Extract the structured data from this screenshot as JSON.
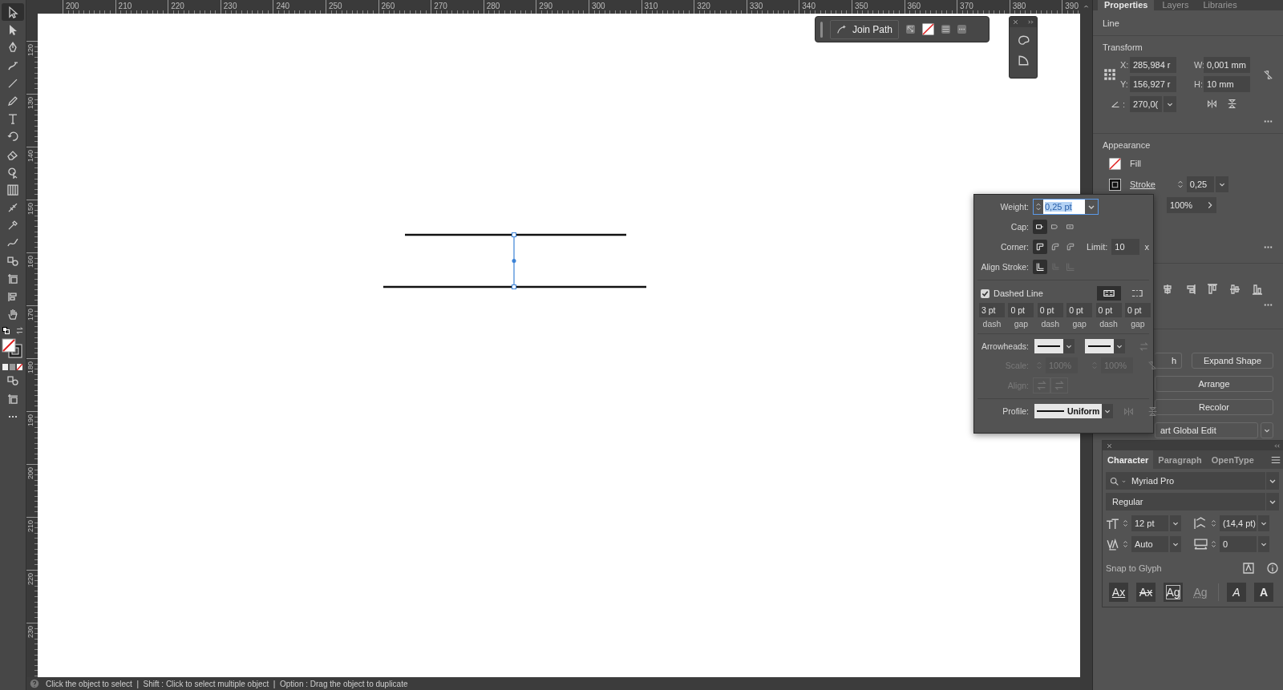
{
  "tools": [
    {
      "kind": "selection",
      "selected": true
    },
    {
      "kind": "direct-selection",
      "selected": false
    },
    {
      "kind": "pen",
      "selected": false
    },
    {
      "kind": "curvature",
      "selected": false
    },
    {
      "kind": "line",
      "selected": false
    },
    {
      "kind": "pencil",
      "selected": false
    },
    {
      "kind": "type",
      "selected": false
    },
    {
      "kind": "rotate",
      "selected": false
    },
    {
      "kind": "eraser",
      "selected": false
    },
    {
      "kind": "shape-builder",
      "selected": false
    },
    {
      "kind": "gradient",
      "selected": false
    },
    {
      "kind": "width",
      "selected": false
    },
    {
      "kind": "eyedropper",
      "selected": false
    },
    {
      "kind": "blend",
      "selected": false
    },
    {
      "kind": "shapes",
      "selected": false
    },
    {
      "kind": "artboard",
      "selected": false
    },
    {
      "kind": "graph",
      "selected": false
    },
    {
      "kind": "hand",
      "selected": false
    }
  ],
  "rulers": {
    "horizontal": [
      "200",
      "210",
      "220",
      "230",
      "240",
      "250",
      "260",
      "270",
      "280",
      "290",
      "300",
      "310",
      "320",
      "330",
      "340",
      "350",
      "360",
      "370",
      "380",
      "390"
    ],
    "vertical": [
      "120",
      "130",
      "140",
      "150",
      "160",
      "170",
      "180",
      "190",
      "200",
      "210",
      "220",
      "230"
    ]
  },
  "control_bar": {
    "join_path": "Join Path"
  },
  "properties_panel": {
    "tabs": [
      {
        "label": "Properties",
        "selected": true
      },
      {
        "label": "Layers",
        "selected": false
      },
      {
        "label": "Libraries",
        "selected": false
      }
    ],
    "object_type": "Line",
    "transform": {
      "title": "Transform",
      "fields": [
        {
          "label": "X:",
          "value": "285,984 r"
        },
        {
          "label": "W:",
          "value": "0,001 mm"
        },
        {
          "label": "Y:",
          "value": "156,927 r"
        },
        {
          "label": "H:",
          "value": "10 mm"
        }
      ],
      "angle_label": ":",
      "angle": "270,0("
    },
    "appearance": {
      "title": "Appearance",
      "fill_label": "Fill",
      "stroke_label": "Stroke",
      "stroke_weight": "0,25",
      "opacity": "100%"
    },
    "quick_actions": [
      {
        "label": "h",
        "kind": "half"
      },
      {
        "label": "Expand Shape",
        "kind": "half"
      },
      {
        "label": "Arrange",
        "kind": "full"
      },
      {
        "label": "Recolor",
        "kind": "full"
      },
      {
        "label": "art Global Edit",
        "kind": "split"
      }
    ]
  },
  "stroke_popup": {
    "weight_label": "Weight:",
    "weight": "0,25 pt",
    "weight_text_selected": true,
    "cap_label": "Cap:",
    "caps": [
      {
        "kind": "butt",
        "selected": true
      },
      {
        "kind": "round",
        "selected": false
      },
      {
        "kind": "projecting",
        "selected": false
      }
    ],
    "corner_label": "Corner:",
    "corners": [
      {
        "kind": "miter",
        "selected": true
      },
      {
        "kind": "round",
        "selected": false
      },
      {
        "kind": "bevel",
        "selected": false
      }
    ],
    "limit_label": "Limit:",
    "limit": "10",
    "limit_unit": "x",
    "align_label": "Align Stroke:",
    "aligns": [
      {
        "kind": "center",
        "selected": true,
        "disabled": false
      },
      {
        "kind": "inside",
        "selected": false,
        "disabled": true
      },
      {
        "kind": "outside",
        "selected": false,
        "disabled": true
      }
    ],
    "dashed": {
      "label": "Dashed Line",
      "checked": true
    },
    "dash_styles": [
      {
        "kind": "exact",
        "selected": true
      },
      {
        "kind": "adjusted",
        "selected": false
      }
    ],
    "dash_fields": [
      {
        "value": "3 pt",
        "label": "dash"
      },
      {
        "value": "0 pt",
        "label": "gap"
      },
      {
        "value": "0 pt",
        "label": "dash"
      },
      {
        "value": "0 pt",
        "label": "gap"
      },
      {
        "value": "0 pt",
        "label": "dash"
      },
      {
        "value": "0 pt",
        "label": "gap"
      }
    ],
    "arrowheads_label": "Arrowheads:",
    "scale": {
      "label": "Scale:",
      "values": [
        "100%",
        "100%"
      ],
      "disabled": true
    },
    "align_arrows": {
      "label": "Align:",
      "disabled": true
    },
    "profile": {
      "label": "Profile:",
      "value": "Uniform"
    }
  },
  "character_panel": {
    "tabs": [
      {
        "label": "Character",
        "selected": true
      },
      {
        "label": "Paragraph",
        "selected": false
      },
      {
        "label": "OpenType",
        "selected": false
      }
    ],
    "font": "Myriad Pro",
    "style": "Regular",
    "size": "12 pt",
    "leading": "(14,4 pt)",
    "kerning": "Auto",
    "tracking": "0",
    "snap_title": "Snap to Glyph",
    "snap_options": [
      {
        "label": "Ax",
        "kind": "baseline",
        "on": true
      },
      {
        "label": "Ax",
        "kind": "strike",
        "on": true
      },
      {
        "label": "Ag",
        "kind": "bounds",
        "on": true
      },
      {
        "label": "Ag",
        "kind": "proximity",
        "on": false
      },
      {
        "label": "A",
        "kind": "angular",
        "on": true
      },
      {
        "label": "A",
        "kind": "anchor",
        "on": true
      }
    ]
  },
  "status_bar": {
    "text": "Click the object to select  |  Shift : Click to select multiple object  |  Option : Drag the object to duplicate"
  }
}
